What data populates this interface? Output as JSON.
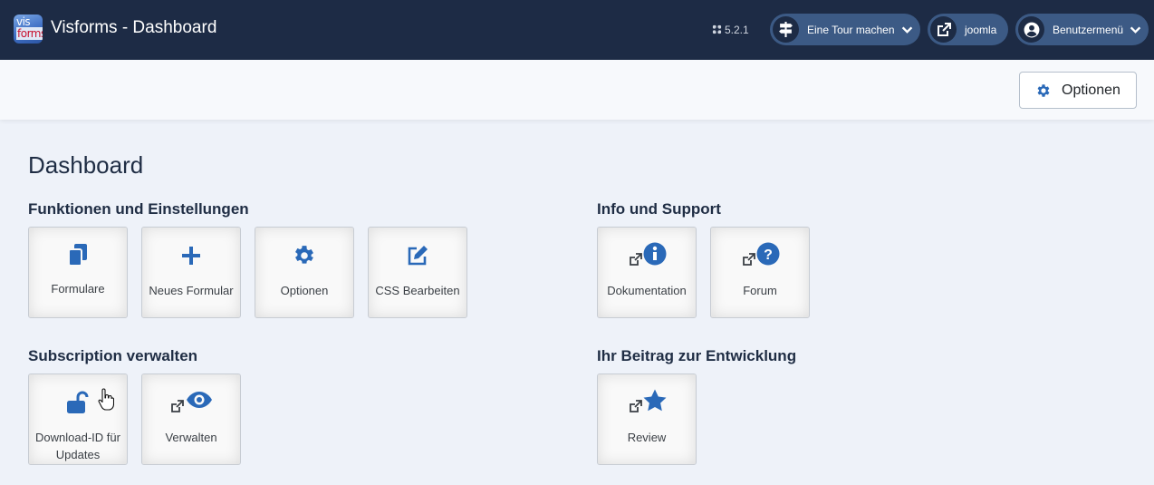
{
  "header": {
    "logo_top": "vis",
    "logo_bottom": "forms",
    "title": "Visforms - Dashboard",
    "version": "5.2.1",
    "tour_label": "Eine Tour machen",
    "site_label": "joomla",
    "user_menu_label": "Benutzermenü"
  },
  "toolbar": {
    "options_label": "Optionen"
  },
  "page_title": "Dashboard",
  "sections": {
    "functions": {
      "title": "Funktionen und Einstellungen",
      "tiles": [
        {
          "label": "Formulare",
          "icon": "copy-icon"
        },
        {
          "label": "Neues Formular",
          "icon": "plus-icon"
        },
        {
          "label": "Optionen",
          "icon": "gear-icon"
        },
        {
          "label": "CSS Bearbeiten",
          "icon": "edit-icon"
        }
      ]
    },
    "support": {
      "title": "Info und Support",
      "tiles": [
        {
          "label": "Dokumentation",
          "icon": "info-icon"
        },
        {
          "label": "Forum",
          "icon": "question-icon"
        }
      ]
    },
    "subscription": {
      "title": "Subscription verwalten",
      "tiles": [
        {
          "label": "Download-ID für Updates",
          "icon": "unlock-icon"
        },
        {
          "label": "Verwalten",
          "icon": "eye-icon"
        }
      ]
    },
    "contribution": {
      "title": "Ihr Beitrag zur Entwicklung",
      "tiles": [
        {
          "label": "Review",
          "icon": "star-icon"
        }
      ]
    }
  },
  "colors": {
    "header_bg": "#1d2b45",
    "header_button_bg": "#3c5a85",
    "icon_blue": "#2a69b8",
    "page_bg": "#eef2f9"
  }
}
